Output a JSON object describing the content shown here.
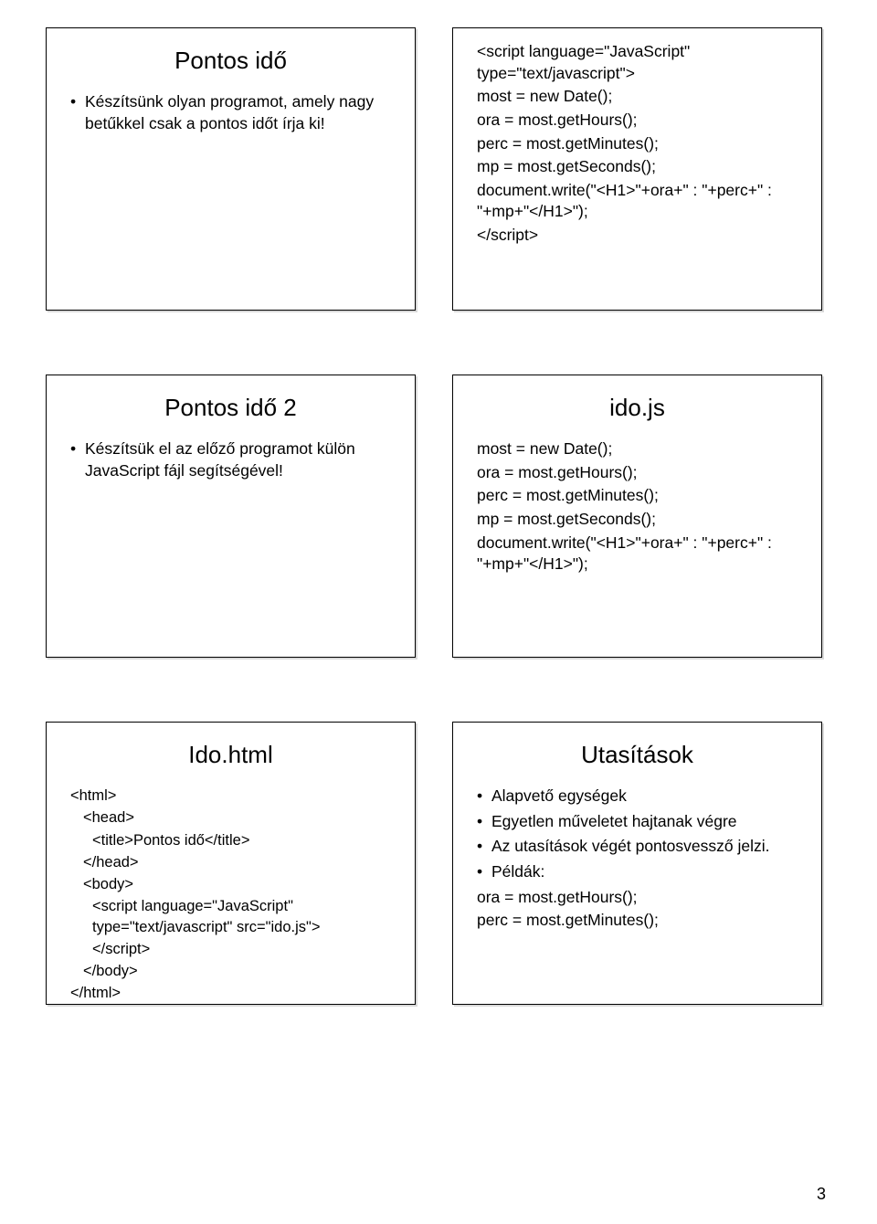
{
  "slides": {
    "s1": {
      "title": "Pontos idő",
      "bullets": [
        "Készítsünk olyan programot, amely nagy betűkkel csak a pontos időt írja ki!"
      ]
    },
    "s2": {
      "lines": [
        "<script language=\"JavaScript\" type=\"text/javascript\">",
        "most = new Date();",
        "ora = most.getHours();",
        "perc = most.getMinutes();",
        "mp = most.getSeconds();",
        "document.write(\"<H1>\"+ora+\" : \"+perc+\" : \"+mp+\"</H1>\");",
        "</script>"
      ]
    },
    "s3": {
      "title": "Pontos idő 2",
      "bullets": [
        "Készítsük el az előző programot külön JavaScript fájl segítségével!"
      ]
    },
    "s4": {
      "title": "ido.js",
      "lines": [
        "most = new Date();",
        "ora = most.getHours();",
        "perc = most.getMinutes();",
        "mp = most.getSeconds();",
        "document.write(\"<H1>\"+ora+\" : \"+perc+\" : \"+mp+\"</H1>\");"
      ]
    },
    "s5": {
      "title": "Ido.html",
      "lines": [
        "<html>",
        "<head>",
        "<title>Pontos idő</title>",
        "</head>",
        "<body>",
        "<script language=\"JavaScript\" type=\"text/javascript\" src=\"ido.js\">",
        "</script>",
        "</body>",
        "</html>"
      ]
    },
    "s6": {
      "title": "Utasítások",
      "bullets": [
        "Alapvető egységek",
        "Egyetlen műveletet hajtanak végre",
        "Az utasítások végét pontosvessző jelzi.",
        "Példák:"
      ],
      "lines": [
        "ora = most.getHours();",
        "perc = most.getMinutes();"
      ]
    }
  },
  "pageNumber": "3"
}
